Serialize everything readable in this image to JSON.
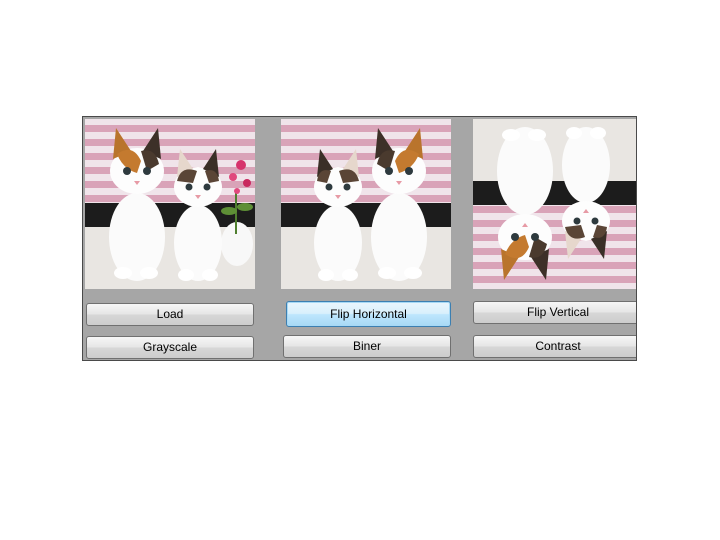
{
  "images": {
    "original": {
      "icon": "kittens-photo-original"
    },
    "flipped_horizontal": {
      "icon": "kittens-photo-flipped-horizontal"
    },
    "flipped_vertical": {
      "icon": "kittens-photo-flipped-vertical"
    }
  },
  "buttons": {
    "load": "Load",
    "grayscale": "Grayscale",
    "flip_horizontal": "Flip Horizontal",
    "biner": "Biner",
    "flip_vertical": "Flip Vertical",
    "contrast": "Contrast"
  },
  "colors": {
    "window_bg": "#a6a6a6",
    "stripe_pink": "#d9a3b8",
    "button_focus_border": "#3c7fb1"
  }
}
